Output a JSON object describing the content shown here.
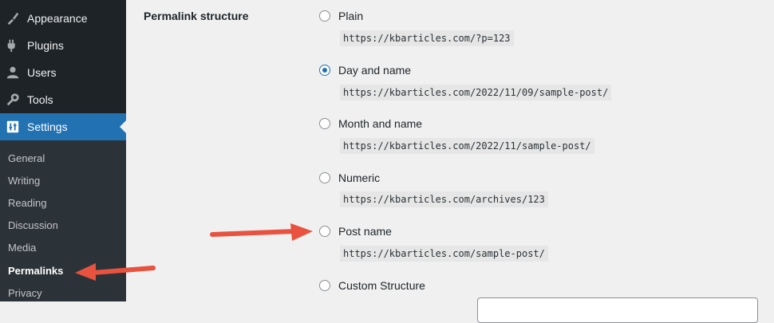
{
  "sidebar": {
    "menu": [
      {
        "label": "Appearance",
        "icon": "paintbrush-icon"
      },
      {
        "label": "Plugins",
        "icon": "plugin-icon"
      },
      {
        "label": "Users",
        "icon": "user-icon"
      },
      {
        "label": "Tools",
        "icon": "wrench-icon"
      },
      {
        "label": "Settings",
        "icon": "settings-sliders-icon",
        "active": true
      }
    ],
    "submenu": [
      "General",
      "Writing",
      "Reading",
      "Discussion",
      "Media",
      "Permalinks",
      "Privacy"
    ],
    "current_submenu": "Permalinks"
  },
  "permalinks": {
    "row_label": "Permalink structure",
    "options": [
      {
        "label": "Plain",
        "example": "https://kbarticles.com/?p=123",
        "checked": false
      },
      {
        "label": "Day and name",
        "example": "https://kbarticles.com/2022/11/09/sample-post/",
        "checked": true
      },
      {
        "label": "Month and name",
        "example": "https://kbarticles.com/2022/11/sample-post/",
        "checked": false
      },
      {
        "label": "Numeric",
        "example": "https://kbarticles.com/archives/123",
        "checked": false
      },
      {
        "label": "Post name",
        "example": "https://kbarticles.com/sample-post/",
        "checked": false
      },
      {
        "label": "Custom Structure",
        "checked": false
      }
    ]
  },
  "colors": {
    "sidebar_bg": "#1d2327",
    "submenu_bg": "#2c3338",
    "accent": "#2271b1",
    "annotation_arrow": "#e8523f",
    "page_bg": "#f0f0f1"
  }
}
